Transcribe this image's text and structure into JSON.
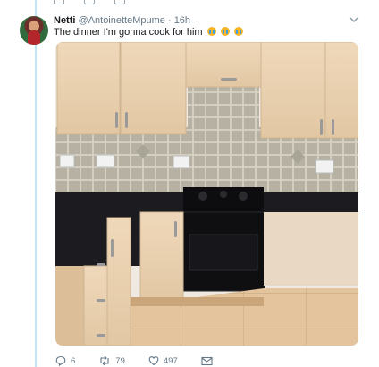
{
  "tweet": {
    "display_name": "Netti",
    "handle": "@AntoinetteMpume",
    "separator": " · ",
    "time": "16h",
    "text": "The dinner I'm gonna cook for him",
    "emojis": [
      "loudly-crying-face-emoji",
      "loudly-crying-face-emoji",
      "loudly-crying-face-emoji"
    ],
    "media": {
      "subject": "kitchen-photo",
      "tiles_accent": "#a9a596",
      "counter": "#1c1c20",
      "cabinet": "#e8cfae"
    }
  },
  "actions": {
    "reply_count": "6",
    "retweet_count": "79",
    "like_count": "497"
  },
  "colors": {
    "accent_rule": "#c4e2f6",
    "muted": "#657786"
  }
}
